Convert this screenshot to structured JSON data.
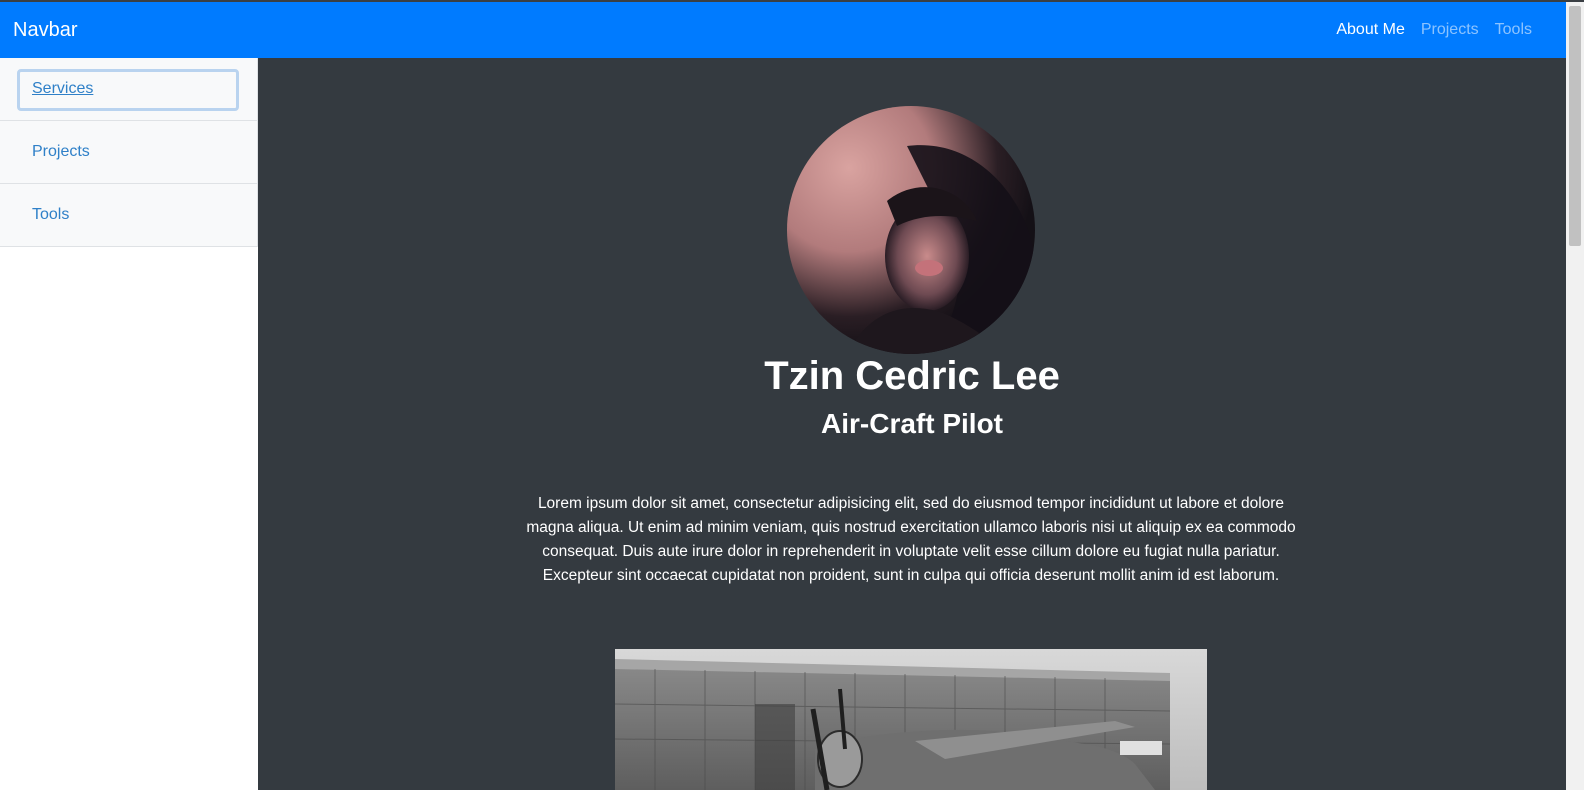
{
  "navbar": {
    "brand": "Navbar",
    "links": [
      {
        "label": "About Me",
        "active": true
      },
      {
        "label": "Projects",
        "active": false
      },
      {
        "label": "Tools",
        "active": false
      }
    ]
  },
  "sidebar": {
    "items": [
      {
        "label": "Services"
      },
      {
        "label": "Projects"
      },
      {
        "label": "Tools"
      }
    ]
  },
  "profile": {
    "name": "Tzin Cedric Lee",
    "role": "Air-Craft Pilot",
    "bio": "Lorem ipsum dolor sit amet, consectetur adipisicing elit, sed do eiusmod tempor incididunt ut labore et dolore magna aliqua. Ut enim ad minim veniam, quis nostrud exercitation ullamco laboris nisi ut aliquip ex ea commodo consequat. Duis aute irure dolor in reprehenderit in voluptate velit esse cillum dolore eu fugiat nulla pariatur. Excepteur sint occaecat cupidatat non proident, sunt in culpa qui officia deserunt mollit anim id est laborum."
  },
  "colors": {
    "navbar_bg": "#007bff",
    "main_bg": "#343a40",
    "sidebar_bg": "#f8f9fa",
    "link": "#2f80c8"
  }
}
